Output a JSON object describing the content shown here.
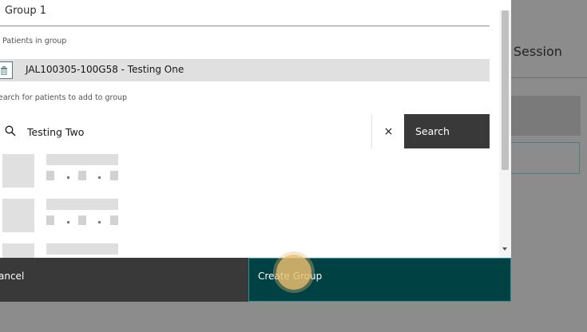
{
  "background": {
    "title_fragment": "o Session"
  },
  "modal": {
    "group_name_value": "Group 1",
    "patients_in_group_label": "Patients in group",
    "members": [
      {
        "label": "JAL100305-100G58 - Testing One"
      }
    ],
    "search_label": "earch for patients to add to group",
    "search": {
      "value": "Testing Two",
      "clear_symbol": "×",
      "button_label": "Search"
    },
    "results_loading_placeholders": 3
  },
  "footer": {
    "cancel_label": "ancel",
    "create_label": "Create Group"
  },
  "colors": {
    "accent": "#004144",
    "accent_border": "#2f8f96",
    "dark_button": "#393939",
    "overlay": "#8c8c8c"
  }
}
